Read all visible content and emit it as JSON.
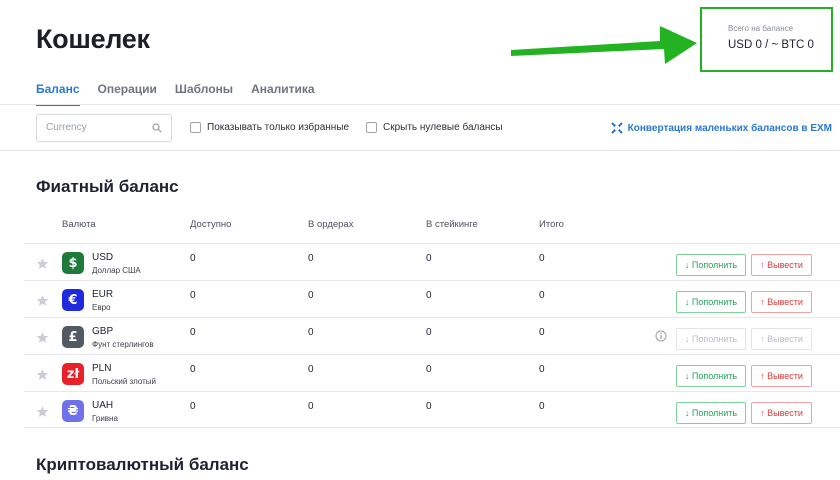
{
  "header": {
    "title": "Кошелек",
    "total_label": "Всего на балансе",
    "total_value": "USD 0 / ~ BTC 0"
  },
  "annotation": {
    "arrow_color": "#22b222"
  },
  "tabs": [
    {
      "label": "Баланс",
      "active": true
    },
    {
      "label": "Операции",
      "active": false
    },
    {
      "label": "Шаблоны",
      "active": false
    },
    {
      "label": "Аналитика",
      "active": false
    }
  ],
  "toolbar": {
    "search_placeholder": "Currency",
    "search_value": "",
    "show_favorites_label": "Показывать только избранные",
    "hide_zero_label": "Скрыть нулевые балансы",
    "convert_label": "Конвертация маленьких балансов в EXM",
    "convert_icon": "exm-convert-icon"
  },
  "fiat": {
    "title": "Фиатный баланс",
    "columns": {
      "currency": "Валюта",
      "available": "Доступно",
      "in_orders": "В ордерах",
      "staking": "В стейкинге",
      "total": "Итого"
    },
    "rows": [
      {
        "code": "USD",
        "name": "Доллар США",
        "symbol": "$",
        "color": "#1d7a3a",
        "available": "0",
        "in_orders": "0",
        "staking": "0",
        "total": "0",
        "deposit": "↓ Пополнить",
        "withdraw": "↑ Вывести",
        "disabled": false
      },
      {
        "code": "EUR",
        "name": "Евро",
        "symbol": "€",
        "color": "#1f2adf",
        "available": "0",
        "in_orders": "0",
        "staking": "0",
        "total": "0",
        "deposit": "↓ Пополнить",
        "withdraw": "↑ Вывести",
        "disabled": false
      },
      {
        "code": "GBP",
        "name": "Фунт стерлингов",
        "symbol": "£",
        "color": "#525a64",
        "available": "0",
        "in_orders": "0",
        "staking": "0",
        "total": "0",
        "deposit": "↓ Пополнить",
        "withdraw": "↑ Вывести",
        "disabled": true
      },
      {
        "code": "PLN",
        "name": "Польский злотый",
        "symbol": "zł",
        "color": "#e8202a",
        "available": "0",
        "in_orders": "0",
        "staking": "0",
        "total": "0",
        "deposit": "↓ Пополнить",
        "withdraw": "↑ Вывести",
        "disabled": false
      },
      {
        "code": "UAH",
        "name": "Гривна",
        "symbol": "₴",
        "color": "#6f72e8",
        "available": "0",
        "in_orders": "0",
        "staking": "0",
        "total": "0",
        "deposit": "↓ Пополнить",
        "withdraw": "↑ Вывести",
        "disabled": false
      }
    ]
  },
  "crypto": {
    "title": "Криптовалютный баланс"
  }
}
